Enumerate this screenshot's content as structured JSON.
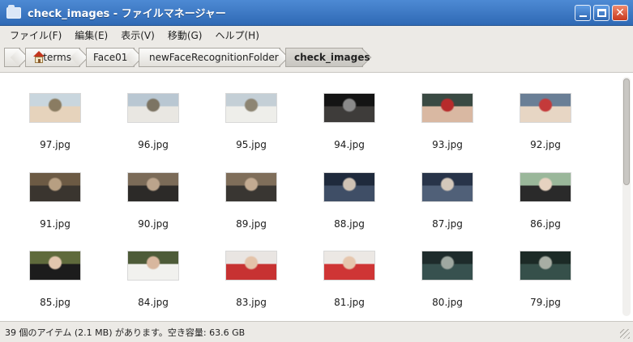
{
  "window": {
    "title": "check_images - ファイルマネージャー",
    "icon": "folder-icon"
  },
  "menu": [
    "ファイル(F)",
    "編集(E)",
    "表示(V)",
    "移動(G)",
    "ヘルプ(H)"
  ],
  "breadcrumb": [
    "terms",
    "Face01",
    "newFaceRecognitionFolder",
    "check_images"
  ],
  "files": [
    {
      "name": "97.jpg",
      "colors": [
        "#c9d6de",
        "#e6d3bc",
        "#8a7c62"
      ]
    },
    {
      "name": "96.jpg",
      "colors": [
        "#b9c7d2",
        "#e9e7e2",
        "#7c7463"
      ]
    },
    {
      "name": "95.jpg",
      "colors": [
        "#c4cfd6",
        "#eeeeea",
        "#8d8573"
      ]
    },
    {
      "name": "94.jpg",
      "colors": [
        "#141414",
        "#3e3c3a",
        "#8a8a8a"
      ]
    },
    {
      "name": "93.jpg",
      "colors": [
        "#3a4a43",
        "#d9b8a2",
        "#b72b2b"
      ]
    },
    {
      "name": "92.jpg",
      "colors": [
        "#6a7f96",
        "#e7d6c4",
        "#c43a3a"
      ]
    },
    {
      "name": "91.jpg",
      "colors": [
        "#6c5a44",
        "#3a352f",
        "#b79f82"
      ]
    },
    {
      "name": "90.jpg",
      "colors": [
        "#7b6b58",
        "#2c2a28",
        "#bba48c"
      ]
    },
    {
      "name": "89.jpg",
      "colors": [
        "#7f6e5a",
        "#393632",
        "#c3ab92"
      ]
    },
    {
      "name": "88.jpg",
      "colors": [
        "#1f2a3c",
        "#3f4e66",
        "#cfc2b4"
      ]
    },
    {
      "name": "87.jpg",
      "colors": [
        "#283449",
        "#506078",
        "#d4c8bb"
      ]
    },
    {
      "name": "86.jpg",
      "colors": [
        "#9ab79a",
        "#2a2a2a",
        "#e6d2c0"
      ]
    },
    {
      "name": "85.jpg",
      "colors": [
        "#5f6a3c",
        "#1c1c1c",
        "#e2c6ae"
      ]
    },
    {
      "name": "84.jpg",
      "colors": [
        "#4d5b38",
        "#f1f1ee",
        "#d8b79e"
      ]
    },
    {
      "name": "83.jpg",
      "colors": [
        "#e9e5e2",
        "#c73232",
        "#e4c3a9"
      ]
    },
    {
      "name": "81.jpg",
      "colors": [
        "#ece8e4",
        "#cf3535",
        "#e6c6ad"
      ]
    },
    {
      "name": "80.jpg",
      "colors": [
        "#1e2b2b",
        "#37514f",
        "#9fa8a1"
      ]
    },
    {
      "name": "79.jpg",
      "colors": [
        "#1c2a26",
        "#36504a",
        "#a8aea4"
      ]
    }
  ],
  "status": "39 個のアイテム (2.1 MB) があります。空き容量: 63.6 GB"
}
